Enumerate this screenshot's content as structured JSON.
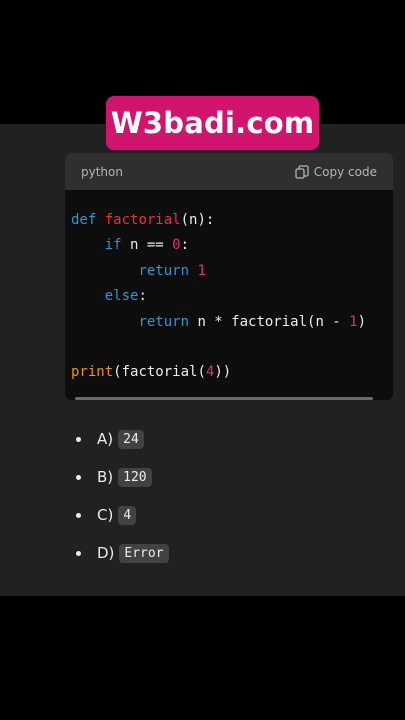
{
  "brand": {
    "text": "W3badi.com",
    "color": "#d1156f"
  },
  "code_block": {
    "language": "python",
    "copy_label": "Copy code",
    "copy_icon": "copy-icon",
    "lines": [
      [
        {
          "t": "def",
          "c": "kw"
        },
        {
          "t": " "
        },
        {
          "t": "factorial",
          "c": "fn"
        },
        {
          "t": "(n):"
        }
      ],
      [
        {
          "t": "    "
        },
        {
          "t": "if",
          "c": "kw"
        },
        {
          "t": " n == "
        },
        {
          "t": "0",
          "c": "num"
        },
        {
          "t": ":"
        }
      ],
      [
        {
          "t": "        "
        },
        {
          "t": "return",
          "c": "kw"
        },
        {
          "t": " "
        },
        {
          "t": "1",
          "c": "num"
        }
      ],
      [
        {
          "t": "    "
        },
        {
          "t": "else",
          "c": "kw"
        },
        {
          "t": ":"
        }
      ],
      [
        {
          "t": "        "
        },
        {
          "t": "return",
          "c": "kw"
        },
        {
          "t": " n * factorial(n - "
        },
        {
          "t": "1",
          "c": "num"
        },
        {
          "t": ")"
        }
      ],
      [],
      [
        {
          "t": "print",
          "c": "bi"
        },
        {
          "t": "(factorial("
        },
        {
          "t": "4",
          "c": "num"
        },
        {
          "t": "))"
        }
      ]
    ],
    "colors": {
      "keyword": "#2e95d3",
      "function": "#f22c3d",
      "number": "#df3079",
      "builtin": "#e9950c"
    }
  },
  "options": [
    {
      "letter": "A)",
      "value": "24"
    },
    {
      "letter": "B)",
      "value": "120"
    },
    {
      "letter": "C)",
      "value": "4"
    },
    {
      "letter": "D)",
      "value": "Error"
    }
  ]
}
